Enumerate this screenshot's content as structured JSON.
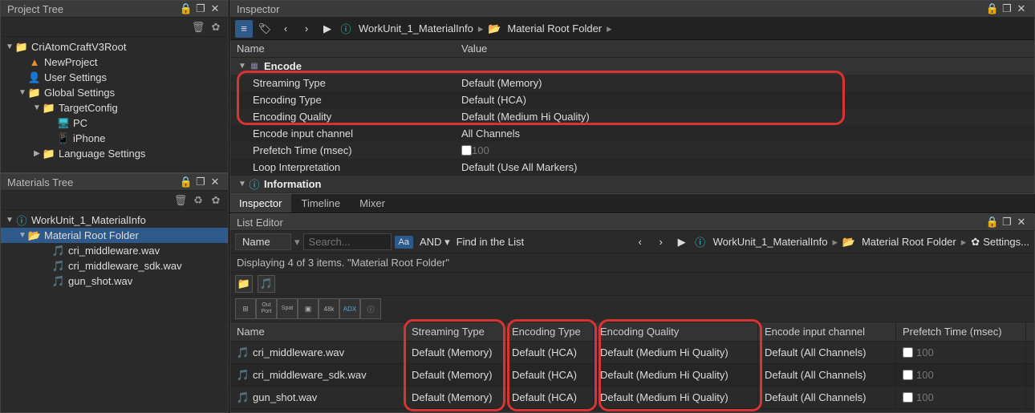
{
  "panels": {
    "projectTree": "Project Tree",
    "materialsTree": "Materials Tree",
    "inspector": "Inspector",
    "listEditor": "List Editor"
  },
  "projectTree": {
    "root": "CriAtomCraftV3Root",
    "items": [
      "NewProject",
      "User Settings",
      "Global Settings",
      "TargetConfig",
      "PC",
      "iPhone",
      "Language Settings"
    ]
  },
  "materialsTree": {
    "root": "WorkUnit_1_MaterialInfo",
    "folder": "Material Root Folder",
    "files": [
      "cri_middleware.wav",
      "cri_middleware_sdk.wav",
      "gun_shot.wav"
    ]
  },
  "inspector": {
    "breadcrumb": {
      "unit": "WorkUnit_1_MaterialInfo",
      "folder": "Material Root Folder"
    },
    "headers": {
      "name": "Name",
      "value": "Value"
    },
    "section1": "Encode",
    "section2": "Information",
    "rows": [
      {
        "name": "Streaming Type",
        "value": "Default (Memory)"
      },
      {
        "name": "Encoding Type",
        "value": "Default (HCA)"
      },
      {
        "name": "Encoding Quality",
        "value": "Default (Medium Hi Quality)"
      },
      {
        "name": "Encode input channel",
        "value": "All Channels"
      },
      {
        "name": "Prefetch Time (msec)",
        "value": "100"
      },
      {
        "name": "Loop Interpretation",
        "value": "Default (Use All Markers)"
      }
    ]
  },
  "tabs": [
    "Inspector",
    "Timeline",
    "Mixer"
  ],
  "listEditor": {
    "filter": {
      "field": "Name",
      "placeholder": "Search...",
      "badge": "Aa",
      "and": "AND",
      "find": "Find in the List"
    },
    "crumb": {
      "unit": "WorkUnit_1_MaterialInfo",
      "folder": "Material Root Folder",
      "settings": "Settings..."
    },
    "status": "Displaying 4 of 3 items. \"Material Root Folder\"",
    "columns": [
      "Name",
      "Streaming Type",
      "Encoding Type",
      "Encoding Quality",
      "Encode input channel",
      "Prefetch Time (msec)"
    ],
    "rows": [
      {
        "name": "cri_middleware.wav",
        "st": "Default (Memory)",
        "et": "Default (HCA)",
        "eq": "Default (Medium Hi Quality)",
        "eic": "Default (All Channels)",
        "pt": "100"
      },
      {
        "name": "cri_middleware_sdk.wav",
        "st": "Default (Memory)",
        "et": "Default (HCA)",
        "eq": "Default (Medium Hi Quality)",
        "eic": "Default (All Channels)",
        "pt": "100"
      },
      {
        "name": "gun_shot.wav",
        "st": "Default (Memory)",
        "et": "Default (HCA)",
        "eq": "Default (Medium Hi Quality)",
        "eic": "Default (All Channels)",
        "pt": "100"
      }
    ]
  }
}
